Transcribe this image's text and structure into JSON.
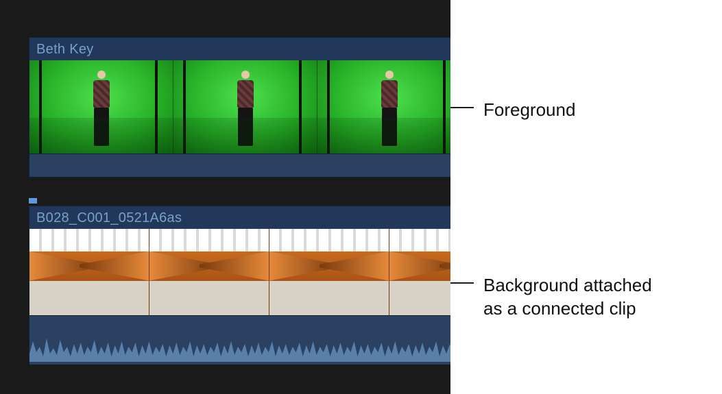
{
  "clips": {
    "foreground": {
      "title": "Beth Key"
    },
    "background": {
      "title": "B028_C001_0521A6as"
    }
  },
  "annotations": {
    "foreground": "Foreground",
    "background": "Background attached as a connected clip"
  }
}
